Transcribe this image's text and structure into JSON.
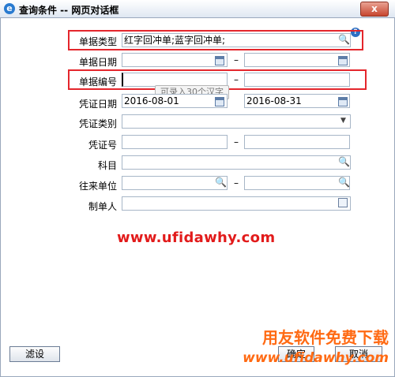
{
  "window": {
    "title": "查询条件 -- 网页对话框",
    "close_label": "x"
  },
  "form": {
    "rows": [
      {
        "label": "单据类型",
        "value": "红字回冲单;蓝字回冲单;"
      },
      {
        "label": "单据日期",
        "value_from": "",
        "value_to": ""
      },
      {
        "label": "单据编号",
        "value_from": "",
        "value_to": ""
      },
      {
        "label": "凭证日期",
        "value_from": "2016-08-01",
        "value_to": "2016-08-31"
      },
      {
        "label": "凭证类别",
        "value": ""
      },
      {
        "label": "凭证号",
        "value_from": "",
        "value_to": ""
      },
      {
        "label": "科目",
        "value": ""
      },
      {
        "label": "往来单位",
        "value_from": "",
        "value_to": ""
      },
      {
        "label": "制单人",
        "value": ""
      }
    ],
    "range_separator": "–",
    "tooltip": "可录入30个汉字"
  },
  "watermark": "www.ufidawhy.com",
  "buttons": {
    "filter": "滤设",
    "confirm": "确定",
    "cancel": "取消"
  },
  "brand": {
    "name": "用友软件免费下载",
    "url": "www.ufidawhy.com"
  }
}
